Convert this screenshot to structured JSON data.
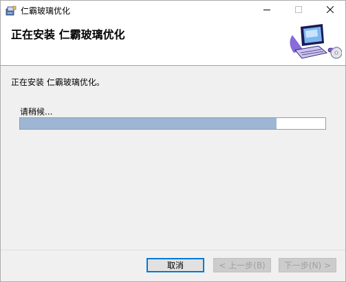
{
  "window": {
    "title": "仁霸玻璃优化",
    "minimize_icon": "minimize-icon",
    "maximize_icon": "maximize-icon",
    "close_icon": "close-icon"
  },
  "header": {
    "title": "正在安装 仁霸玻璃优化"
  },
  "body": {
    "status_text": "正在安装 仁霸玻璃优化。",
    "wait_label": "请稍候...",
    "progress": 0.84
  },
  "footer": {
    "cancel_label": "取消",
    "back_label": "< 上一步(B)",
    "next_label": "下一步(N) >"
  },
  "colors": {
    "progress_fill": "#9db6d4",
    "accent": "#0078d7"
  }
}
